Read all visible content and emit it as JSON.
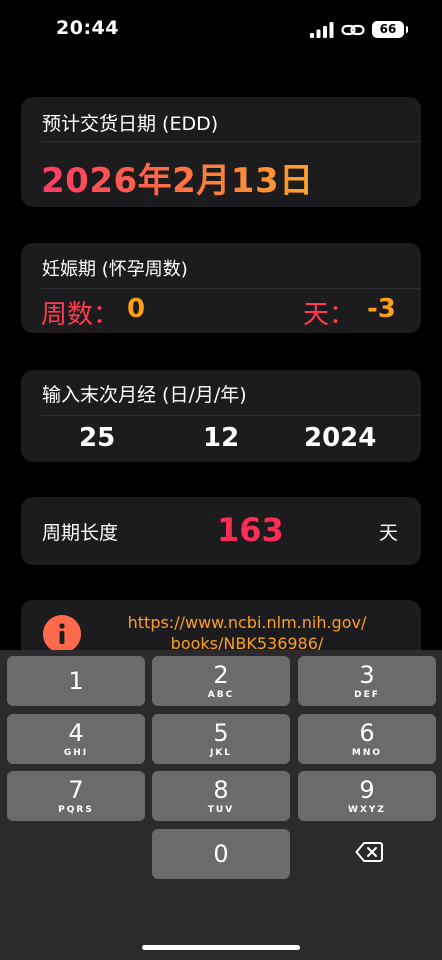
{
  "status": {
    "time": "20:44",
    "battery": "66",
    "icons": [
      "signal-icon",
      "link-icon",
      "battery-icon"
    ]
  },
  "edd": {
    "label": "预计交货日期 (EDD)",
    "value": "2026年2月13日"
  },
  "gestation": {
    "label": "妊娠期 (怀孕周数)",
    "weeks_label": "周数：",
    "weeks_value": "0",
    "days_label": "天：",
    "days_value": "-3"
  },
  "lmp": {
    "label": "输入末次月经 (日/月/年)",
    "day": "25",
    "month": "12",
    "year": "2024"
  },
  "cycle": {
    "label": "周期长度",
    "value": "163",
    "unit": "天"
  },
  "reference": {
    "icon": "info-icon",
    "line1": "https://www.ncbi.nlm.nih.gov/",
    "line2": "books/NBK536986/"
  },
  "keyboard": {
    "keys": [
      {
        "num": "1",
        "letters": ""
      },
      {
        "num": "2",
        "letters": "ABC"
      },
      {
        "num": "3",
        "letters": "DEF"
      },
      {
        "num": "4",
        "letters": "GHI"
      },
      {
        "num": "5",
        "letters": "JKL"
      },
      {
        "num": "6",
        "letters": "MNO"
      },
      {
        "num": "7",
        "letters": "PQRS"
      },
      {
        "num": "8",
        "letters": "TUV"
      },
      {
        "num": "9",
        "letters": "WXYZ"
      },
      {
        "num": "0",
        "letters": ""
      }
    ],
    "delete_icon": "delete-icon"
  },
  "colors": {
    "accent_red": "#ff3a4d",
    "accent_orange": "#ff9f1c",
    "cycle_pink": "#ff2d55",
    "card_bg": "#1c1c1e"
  }
}
